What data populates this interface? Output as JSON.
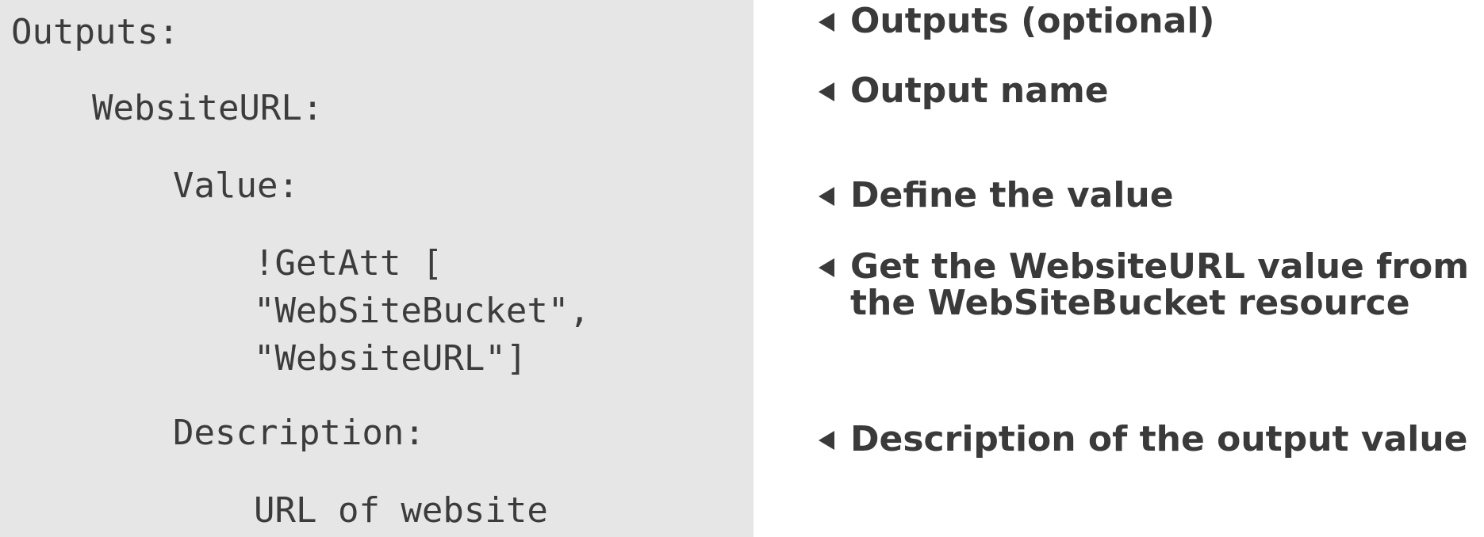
{
  "code": {
    "lines": [
      "Outputs:",
      "WebsiteURL:",
      "Value:",
      "!GetAtt [",
      "\"WebSiteBucket\",",
      "\"WebsiteURL\"]",
      "Description:",
      "URL of website"
    ]
  },
  "annotations": [
    "Outputs (optional)",
    "Output name",
    "Define the value",
    "Get the WebsiteURL value from\nthe WebSiteBucket resource",
    "Description of the output value"
  ],
  "colors": {
    "code_background": "#e6e6e6",
    "code_text": "#3c3c3c",
    "annotation_text": "#3a3a3a"
  }
}
